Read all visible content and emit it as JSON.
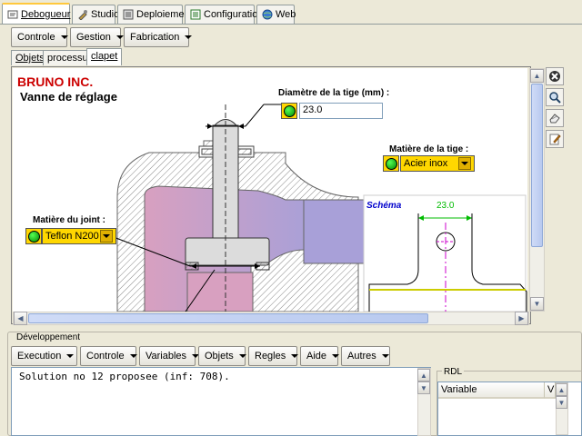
{
  "top_tabs": [
    {
      "label": "Debogueur",
      "icon": "debugger-icon"
    },
    {
      "label": "Studio",
      "icon": "studio-icon"
    },
    {
      "label": "Deploiement",
      "icon": "deployment-icon"
    },
    {
      "label": "Configuration",
      "icon": "configuration-icon"
    },
    {
      "label": "Web",
      "icon": "globe-icon"
    }
  ],
  "main_menu": [
    "Controle",
    "Gestion",
    "Fabrication"
  ],
  "sub_tabs": [
    "Objets",
    "processus",
    "clapet"
  ],
  "drawing": {
    "brand": "BRUNO INC.",
    "title": "Vanne de réglage",
    "stem_diameter_label": "Diamètre de la tige (mm) :",
    "stem_diameter_value": "23.0",
    "stem_material_label": "Matière de la tige :",
    "stem_material_value": "Acier inox",
    "joint_material_label": "Matière du joint :",
    "joint_material_value": "Teflon N200",
    "schema_label": "Schéma",
    "schema_dimension": "23.0"
  },
  "development": {
    "label": "Développement",
    "menu": [
      "Execution",
      "Controle",
      "Variables",
      "Objets",
      "Regles",
      "Aide",
      "Autres"
    ],
    "console_text": "Solution no 12 proposee (inf: 708).",
    "rdl_label": "RDL",
    "rdl_columns": [
      "Variable",
      "V"
    ]
  },
  "colors": {
    "brand_red": "#cc0000",
    "field_yellow": "#ffd700",
    "led_green": "#00aa00",
    "schema_blue": "#0000cc",
    "dimension_green": "#00bb00",
    "axis_magenta": "#cc00cc"
  }
}
